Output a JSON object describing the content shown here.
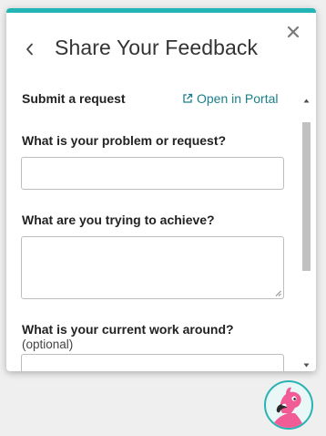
{
  "header": {
    "title": "Share Your Feedback"
  },
  "form": {
    "section_label": "Submit a request",
    "portal_link": "Open in Portal",
    "fields": [
      {
        "label": "What is your problem or request?",
        "value": ""
      },
      {
        "label": "What are you trying to achieve?",
        "value": ""
      },
      {
        "label": "What is your current work around?",
        "note": "(optional)",
        "value": ""
      }
    ]
  },
  "colors": {
    "accent": "#22b5b5",
    "link": "#1a7f8a",
    "avatar_pink": "#f25c96"
  },
  "icons": {
    "back": "chevron-left-icon",
    "close": "close-icon",
    "portal": "external-link-icon",
    "avatar": "flamingo-icon"
  }
}
